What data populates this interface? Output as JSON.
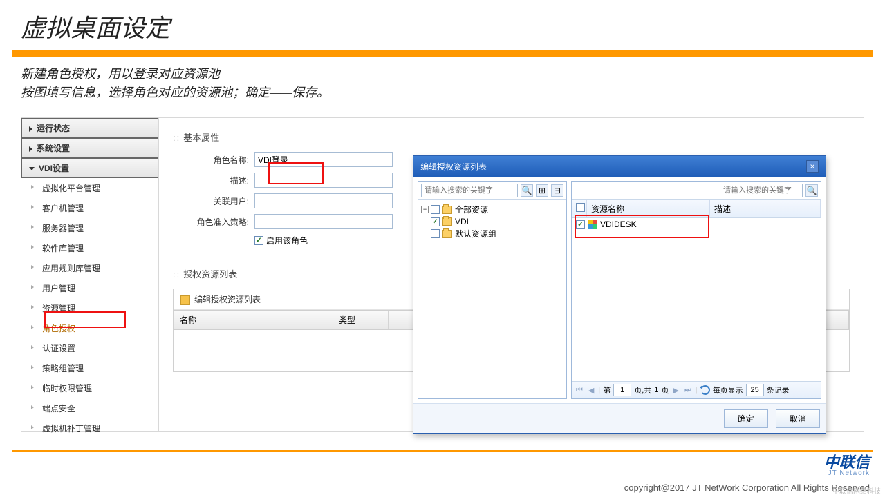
{
  "slide": {
    "title": "虚拟桌面设定",
    "subtitle1": "新建角色授权，用以登录对应资源池",
    "subtitle2": "按图填写信息，选择角色对应的资源池；确定——保存。"
  },
  "sidebar": {
    "items": [
      {
        "label": "运行状态"
      },
      {
        "label": "系统设置"
      },
      {
        "label": "VDI设置",
        "children": [
          "虚拟化平台管理",
          "客户机管理",
          "服务器管理",
          "软件库管理",
          "应用规则库管理",
          "用户管理",
          "资源管理",
          "角色授权",
          "认证设置",
          "策略组管理",
          "临时权限管理",
          "端点安全",
          "虚拟机补丁管理"
        ]
      }
    ]
  },
  "form": {
    "section_basic": "基本属性",
    "labels": {
      "role_name": "角色名称:",
      "desc": "描述:",
      "users": "关联用户:",
      "policy": "角色准入策略:",
      "enable": "启用该角色"
    },
    "values": {
      "role_name": "VDI登录"
    },
    "section_auth": "授权资源列表",
    "auth_edit": "编辑授权资源列表",
    "grid": {
      "col_name": "名称",
      "col_type": "类型"
    }
  },
  "dialog": {
    "title": "编辑授权资源列表",
    "search_placeholder": "请输入搜索的关键字",
    "tree": {
      "root": "全部资源",
      "node_vdi": "VDI",
      "node_default": "默认资源组"
    },
    "grid": {
      "col_name": "资源名称",
      "col_desc": "描述"
    },
    "rows": [
      {
        "name": "VDIDESK"
      }
    ],
    "pager": {
      "label_page": "第",
      "page": "1",
      "label_of": "页,共",
      "total_pages": "1",
      "label_unit": "页",
      "per_page_label": "每页显示",
      "per_page": "25",
      "per_page_unit": "条记录"
    },
    "buttons": {
      "ok": "确定",
      "cancel": "取消"
    }
  },
  "footer": {
    "logo_cn": "中联信",
    "logo_en": "JT Network",
    "copyright": "copyright@2017  JT NetWork Corporation All Rights Reserved",
    "watermark": "中联信网络科技"
  }
}
